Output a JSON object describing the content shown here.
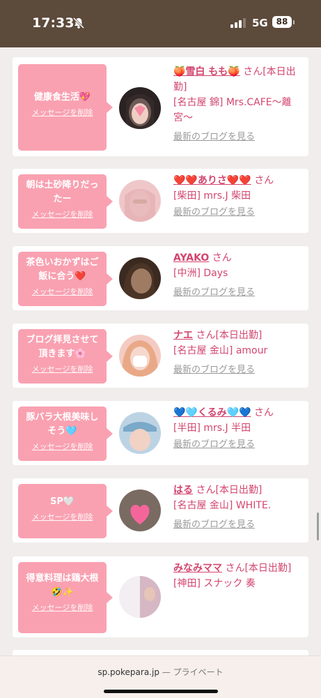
{
  "status": {
    "time": "17:33",
    "network": "5G",
    "battery": "88"
  },
  "colors": {
    "accent": "#d2456f",
    "bubble": "#f9a1b1",
    "header": "#5c4a3b"
  },
  "messages": [
    {
      "bubble": "健康食生活💖",
      "delete": "メッセージを削除",
      "name": "🍑雪白 もも🍑",
      "suffix": "さん[本日出勤]",
      "shop": "[名古屋 錦] Mrs.CAFE〜離宮〜",
      "blog": "最新のブログを見る"
    },
    {
      "bubble": "朝は土砂降りだったー",
      "delete": "メッセージを削除",
      "name": "❤️❤️ありさ❤️❤️",
      "suffix": "さん",
      "shop": "[柴田] mrs.J 柴田",
      "blog": "最新のブログを見る"
    },
    {
      "bubble": "茶色いおかずはご飯に合う❤️",
      "delete": "メッセージを削除",
      "name": "AYAKO",
      "suffix": "さん",
      "shop": "[中洲] Days",
      "blog": "最新のブログを見る"
    },
    {
      "bubble": "ブログ拝見させて頂きます🌸",
      "delete": "メッセージを削除",
      "name": "ナエ",
      "suffix": "さん[本日出勤]",
      "shop": "[名古屋 金山] amour",
      "blog": "最新のブログを見る"
    },
    {
      "bubble": "豚バラ大根美味しそう🩵",
      "delete": "メッセージを削除",
      "name": "💙🩵くるみ🩵💙",
      "suffix": "さん",
      "shop": "[半田] mrs.J 半田",
      "blog": "最新のブログを見る"
    },
    {
      "bubble": "SP🤍",
      "delete": "メッセージを削除",
      "name": "はる",
      "suffix": "さん[本日出勤]",
      "shop": "[名古屋 金山] WHITE.",
      "blog": "最新のブログを見る"
    },
    {
      "bubble": "得意料理は鶏大根🤣✨",
      "delete": "メッセージを削除",
      "name": "みなみママ",
      "suffix": "さん[本日出勤]",
      "shop": "[神田] スナック 奏",
      "blog": ""
    }
  ],
  "browser": {
    "domain": "sp.pokepara.jp",
    "mode": "— プライベート"
  }
}
